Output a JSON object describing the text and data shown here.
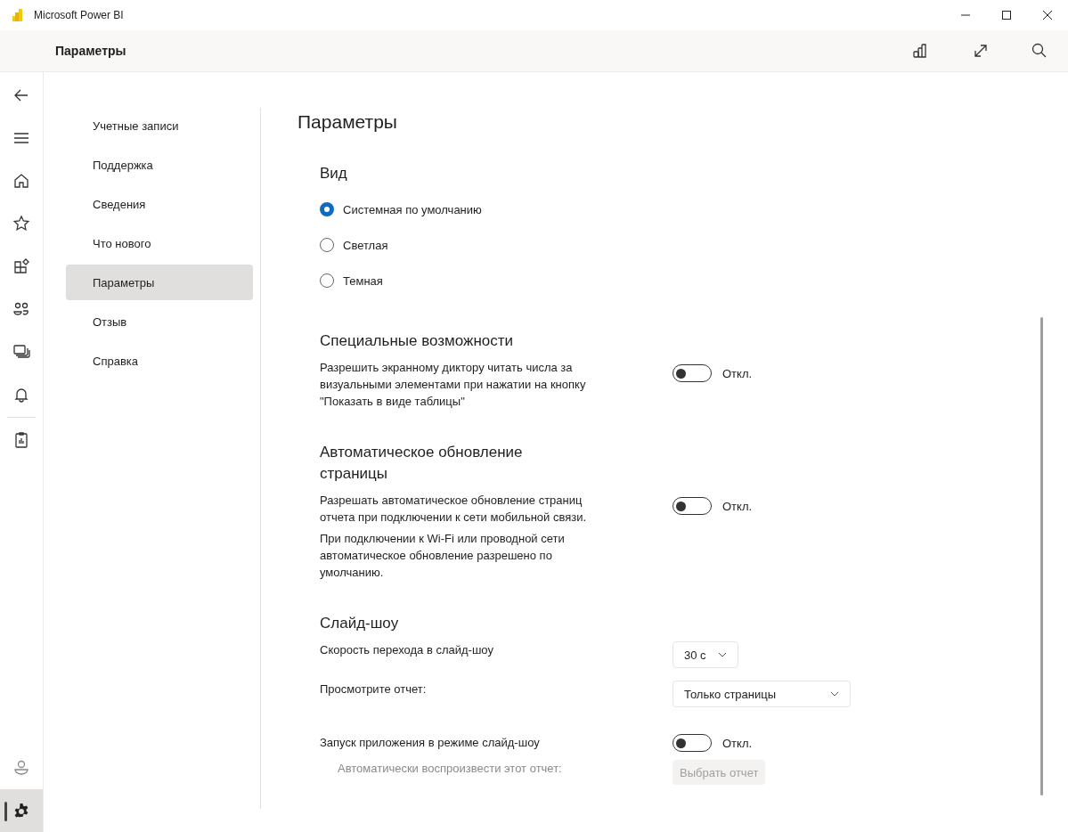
{
  "window": {
    "title": "Microsoft Power BI"
  },
  "header": {
    "title": "Параметры"
  },
  "rail": {
    "top": [
      {
        "kind": "back",
        "selected": false
      },
      {
        "kind": "menu",
        "selected": false
      },
      {
        "kind": "home",
        "selected": false
      },
      {
        "kind": "star",
        "selected": false
      },
      {
        "kind": "apps",
        "selected": false
      },
      {
        "kind": "people",
        "selected": false
      },
      {
        "kind": "workspaces",
        "selected": false
      },
      {
        "kind": "bell",
        "selected": false
      }
    ],
    "middle": [
      {
        "kind": "report",
        "selected": false
      }
    ],
    "bottom": [
      {
        "kind": "account",
        "selected": false
      },
      {
        "kind": "settings",
        "selected": true
      }
    ]
  },
  "menu": [
    {
      "label": "Учетные записи",
      "selected": false
    },
    {
      "label": "Поддержка",
      "selected": false
    },
    {
      "label": "Сведения",
      "selected": false
    },
    {
      "label": "Что нового",
      "selected": false
    },
    {
      "label": "Параметры",
      "selected": true
    },
    {
      "label": "Отзыв",
      "selected": false
    },
    {
      "label": "Справка",
      "selected": false
    }
  ],
  "content": {
    "title": "Параметры",
    "sections": [
      {
        "heading": "Вид",
        "rows": [
          {
            "kind": "radio",
            "label": "Системная по умолчанию",
            "selected": true
          },
          {
            "kind": "radio",
            "label": "Светлая",
            "selected": false
          },
          {
            "kind": "radio",
            "label": "Темная",
            "selected": false
          }
        ]
      },
      {
        "heading": "Специальные возможности",
        "rows": [
          {
            "kind": "toggle",
            "texts": [
              "Разрешить экранному диктору читать числа за визуальными элементами при нажатии на кнопку \"Показать в виде таблицы\""
            ],
            "on": false,
            "state_label": "Откл."
          }
        ]
      },
      {
        "heading": "Автоматическое обновление страницы",
        "rows": [
          {
            "kind": "toggle",
            "texts": [
              "Разрешать автоматическое обновление страниц отчета при подключении к сети мобильной связи.",
              "При подключении к Wi-Fi или проводной сети автоматическое обновление разрешено по умолчанию."
            ],
            "on": false,
            "state_label": "Откл."
          }
        ]
      },
      {
        "heading": "Слайд-шоу",
        "rows": [
          {
            "kind": "select",
            "texts": [
              "Скорость перехода в слайд-шоу"
            ],
            "value": "30 с",
            "wide": false
          },
          {
            "kind": "select",
            "texts": [
              "Просмотрите отчет:"
            ],
            "value": "Только страницы",
            "wide": true
          },
          {
            "kind": "toggle",
            "texts": [
              "Запуск приложения в режиме слайд-шоу"
            ],
            "on": false,
            "state_label": "Откл."
          },
          {
            "kind": "button",
            "texts": [
              "Автоматически воспроизвести этот отчет:"
            ],
            "label": "Выбрать отчет",
            "disabled": true
          }
        ]
      }
    ]
  }
}
